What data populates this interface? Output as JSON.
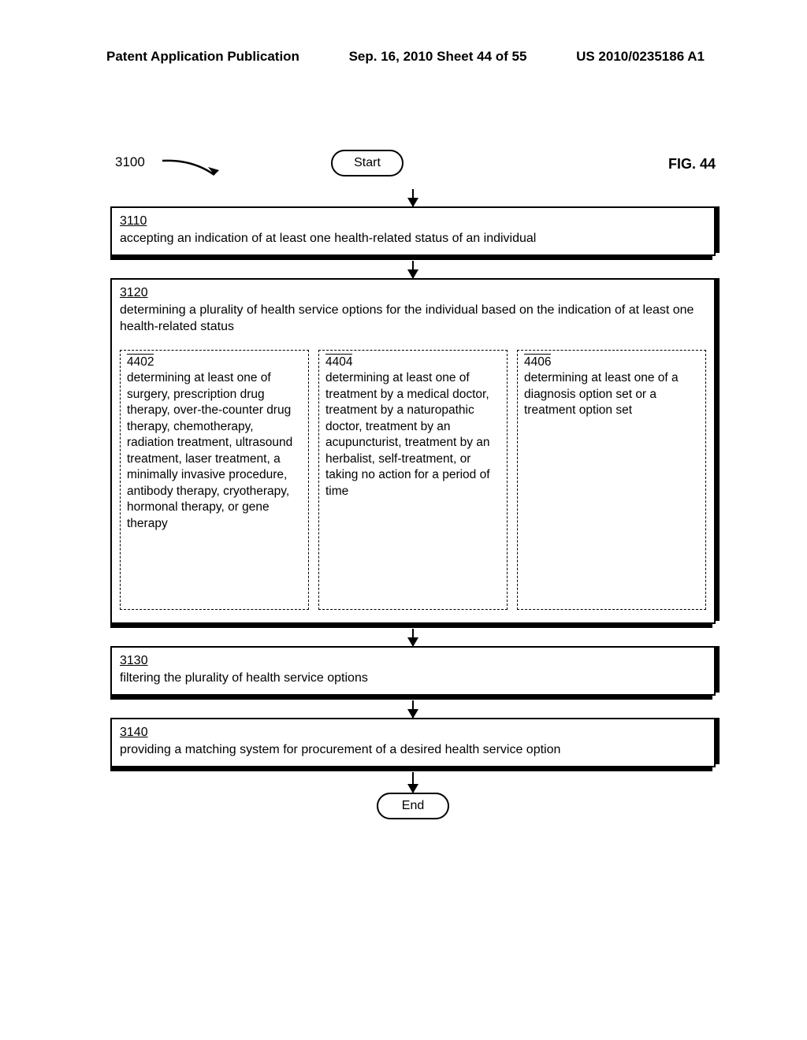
{
  "header": {
    "left": "Patent Application Publication",
    "center": "Sep. 16, 2010  Sheet 44 of 55",
    "right": "US 2010/0235186 A1"
  },
  "fig": {
    "ref": "3100",
    "label": "FIG. 44",
    "start": "Start",
    "end": "End"
  },
  "boxes": {
    "b3110": {
      "num": "3110",
      "text": "accepting an indication of at least one health-related status of an individual"
    },
    "b3120": {
      "num": "3120",
      "text": "determining a plurality of health service options for the individual based on the indication of at least one health-related status"
    },
    "b3130": {
      "num": "3130",
      "text": "filtering the plurality of health service options"
    },
    "b3140": {
      "num": "3140",
      "text": "providing a matching system for procurement of a desired health service option"
    }
  },
  "subs": {
    "s4402": {
      "num": "4402",
      "text": "determining at least one of surgery, prescription drug therapy, over-the-counter drug therapy, chemotherapy, radiation treatment, ultrasound treatment, laser treatment, a minimally invasive procedure, antibody therapy, cryotherapy, hormonal therapy, or gene therapy"
    },
    "s4404": {
      "num": "4404",
      "text": "determining at least one of treatment by a medical doctor, treatment by a naturopathic doctor, treatment by an acupuncturist, treatment by an herbalist, self-treatment, or taking no action for a period of time"
    },
    "s4406": {
      "num": "4406",
      "text": "determining at least one of a diagnosis option set or a treatment option set"
    }
  }
}
